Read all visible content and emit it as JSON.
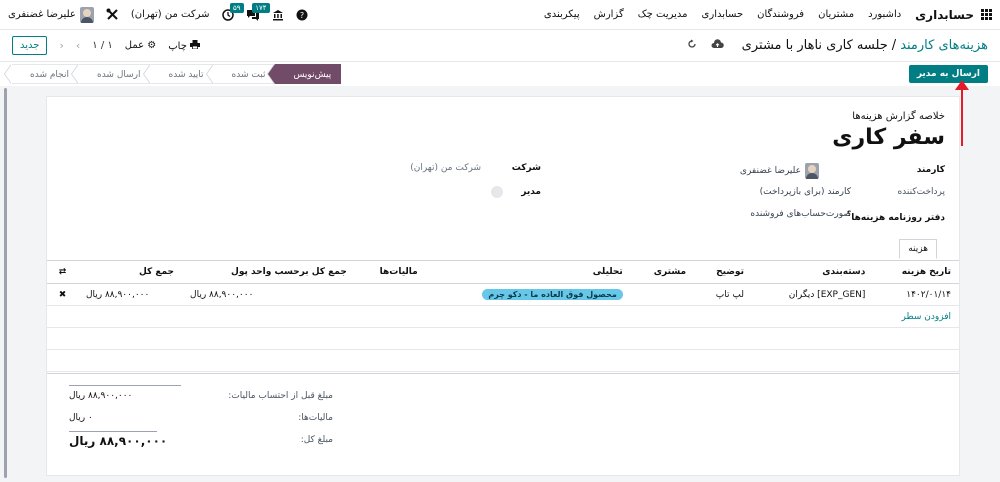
{
  "topbar": {
    "app_title": "حسابداری",
    "menu": [
      "داشبورد",
      "مشتریان",
      "فروشندگان",
      "حسابداری",
      "مدیریت چک",
      "گزارش",
      "پیکربندی"
    ],
    "chat_badge": "۱۷۴",
    "activity_badge": "۵۹",
    "company": "شرکت من (تهران)",
    "user_name": "علیرضا غضنفری"
  },
  "controlbar": {
    "breadcrumb_parent": "هزینه‌های کارمند",
    "breadcrumb_sep": "/",
    "breadcrumb_current": "جلسه کاری ناهار با مشتری",
    "print_label": "چاپ",
    "action_label": "عمل",
    "pager": "۱ / ۱",
    "new_label": "جدید"
  },
  "statusbar": {
    "send_label": "ارسال به مدیر",
    "stages": [
      "پیش‌نویس",
      "ثبت شده",
      "تایید شده",
      "ارسال شده",
      "انجام شده"
    ],
    "active_stage": 0
  },
  "form": {
    "subtitle": "خلاصه گزارش هزینه‌ها",
    "title": "سفر کاری",
    "employee_label": "کارمند",
    "employee_value": "علیرضا غضنفری",
    "payer_label": "پرداخت‌کننده",
    "payer_value": "کارمند (برای بازپرداخت)",
    "journal_label": "دفتر روزنامه هزینه‌ها",
    "journal_hint": "؟",
    "journal_value": "صورت‌حساب‌های فروشنده",
    "company_label": "شرکت",
    "company_value": "شرکت من (تهران)",
    "manager_label": "مدیر"
  },
  "tab": {
    "label": "هزینه"
  },
  "table": {
    "headers": [
      "تاریخ هزینه",
      "دسته‌بندی",
      "توضیح",
      "مشتری",
      "تحلیلی",
      "مالیات‌ها",
      "جمع کل برحسب واحد پول",
      "جمع کل"
    ],
    "rows": [
      {
        "date": "۱۴۰۲/۰۱/۱۴",
        "category": "[EXP_GEN] دیگران",
        "description": "لپ تاپ",
        "customer": "",
        "analytic": "محصول فوق العاده ما - دکو چرم",
        "taxes": "",
        "total_currency": "۸۸,۹۰۰,۰۰۰ ریال",
        "total": "۸۸,۹۰۰,۰۰۰ ریال"
      }
    ],
    "add_line": "افزودن سطر"
  },
  "totals": {
    "untaxed_label": "مبلغ قبل از احتساب مالیات:",
    "untaxed_value": "۸۸,۹۰۰,۰۰۰ ریال",
    "taxes_label": "مالیات‌ها:",
    "taxes_value": "۰ ریال",
    "total_label": "مبلغ کل:",
    "total_value": "۸۸,۹۰۰,۰۰۰ ریال"
  },
  "colors": {
    "accent": "#017e84",
    "stage_active": "#714b67",
    "tag": "#67c7e9",
    "arrow": "#e11d2a"
  }
}
